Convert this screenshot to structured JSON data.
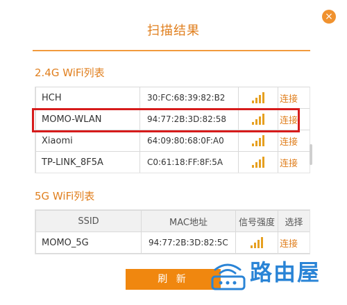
{
  "dialog": {
    "title": "扫描结果",
    "close_glyph": "×"
  },
  "wifi_24g": {
    "section_title": "2.4G WiFi列表",
    "rows": [
      {
        "ssid": "HCH",
        "mac": "30:FC:68:39:82:B2",
        "signal_icon": "signal-bars-icon",
        "action": "连接"
      },
      {
        "ssid": "MOMO-WLAN",
        "mac": "94:77:2B:3D:82:58",
        "signal_icon": "signal-bars-icon",
        "action": "连接"
      },
      {
        "ssid": "Xiaomi",
        "mac": "64:09:80:68:0F:A0",
        "signal_icon": "signal-bars-icon",
        "action": "连接"
      },
      {
        "ssid": "TP-LINK_8F5A",
        "mac": "C0:61:18:FF:8F:5A",
        "signal_icon": "signal-bars-icon",
        "action": "连接"
      }
    ]
  },
  "wifi_5g": {
    "section_title": "5G WiFi列表",
    "headers": [
      "SSID",
      "MAC地址",
      "信号强度",
      "选择"
    ],
    "rows": [
      {
        "ssid": "MOMO_5G",
        "mac": "94:77:2B:3D:82:5C",
        "signal_icon": "signal-bars-icon",
        "action": "连接"
      }
    ]
  },
  "refresh_label": "刷 新",
  "watermark": {
    "text": "路由屋"
  },
  "colors": {
    "accent": "#e07f1e",
    "button": "#f0870f",
    "highlight": "#d61b1b",
    "signal": "#e6a020",
    "watermark": "#2a84d6"
  }
}
